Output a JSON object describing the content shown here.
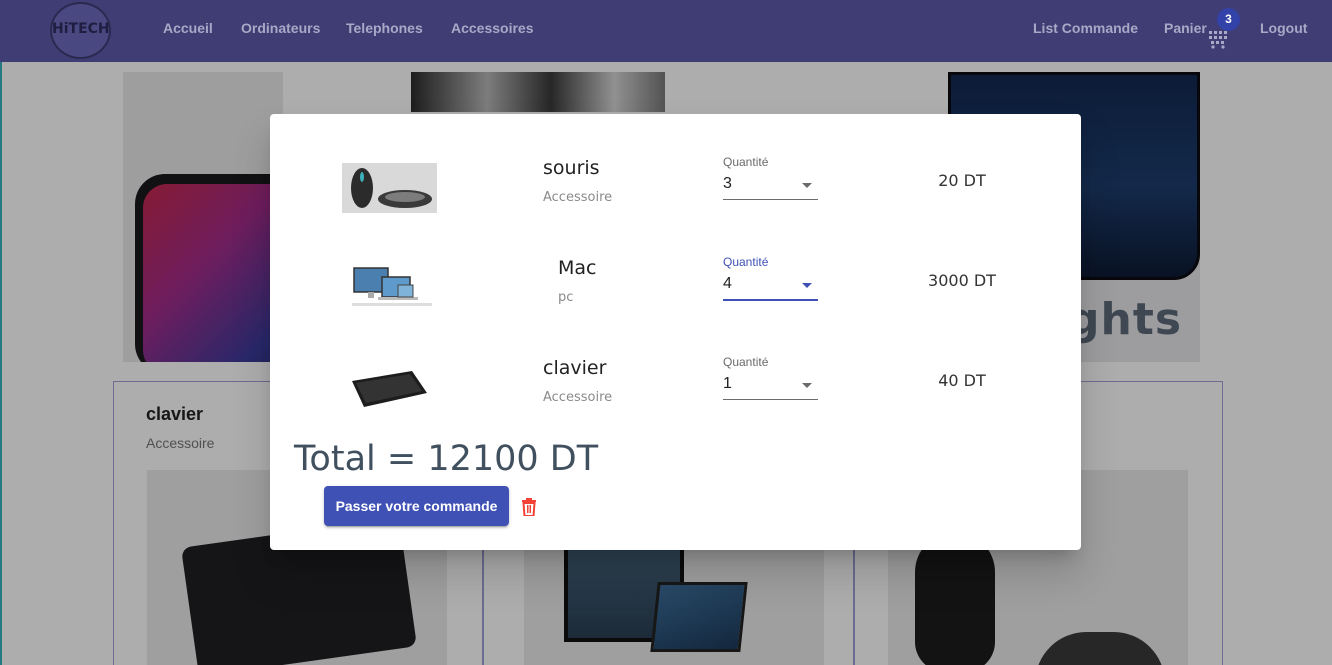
{
  "navbar": {
    "logo_text": "HiTECH",
    "links": [
      "Accueil",
      "Ordinateurs",
      "Telephones",
      "Accessoires"
    ],
    "right_links": {
      "list": "List Commande",
      "cart": "Panier",
      "logout": "Logout"
    },
    "cart_count": "3",
    "cart_icon": "cart-icon"
  },
  "background": {
    "banner_text": "ghts",
    "cards": [
      {
        "title": "clavier",
        "category": "Accessoire"
      }
    ]
  },
  "modal": {
    "items": [
      {
        "name": "souris",
        "category": "Accessoire",
        "quantity_label": "Quantité",
        "quantity": "3",
        "price": "20 DT"
      },
      {
        "name": "Mac",
        "category": "pc",
        "quantity_label": "Quantité",
        "quantity": "4",
        "price": "3000 DT"
      },
      {
        "name": "clavier",
        "category": "Accessoire",
        "quantity_label": "Quantité",
        "quantity": "1",
        "price": "40 DT"
      }
    ],
    "total": "Total = 12100 DT",
    "order_button": "Passer votre commande",
    "delete_icon": "trash-icon"
  },
  "colors": {
    "navbar": "#3f3d74",
    "primary": "#3f51b5",
    "delete": "#f44336"
  }
}
